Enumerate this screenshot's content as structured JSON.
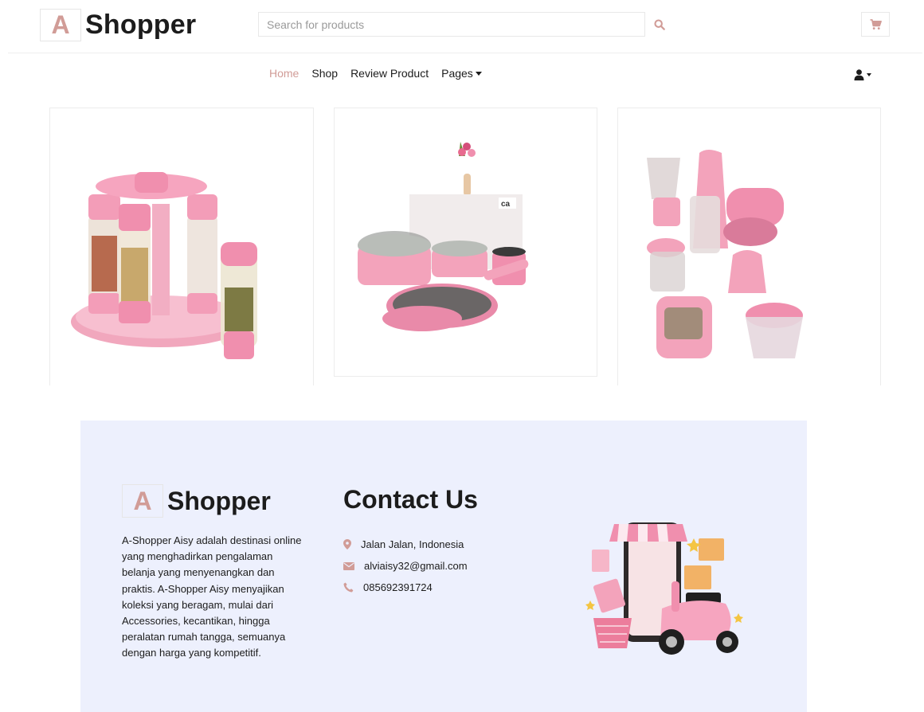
{
  "brand": {
    "logo_letter": "A",
    "logo_word": "Shopper"
  },
  "search": {
    "placeholder": "Search for products"
  },
  "colors": {
    "accent": "#d19c97",
    "footer_bg": "#edf0fd",
    "text": "#1c1c1c"
  },
  "icons": {
    "search": "search-icon",
    "cart": "cart-icon",
    "user": "user-icon",
    "location": "map-marker-icon",
    "email": "envelope-icon",
    "phone": "phone-icon"
  },
  "nav": {
    "items": [
      {
        "label": "Home",
        "active": true
      },
      {
        "label": "Shop"
      },
      {
        "label": "Review Product"
      },
      {
        "label": "Pages"
      }
    ]
  },
  "footer": {
    "about": "A-Shopper Aisy adalah destinasi online yang menghadirkan pengalaman belanja yang menyenangkan dan praktis. A-Shopper Aisy menyajikan koleksi yang beragam, mulai dari Accessories, kecantikan, hingga peralatan rumah tangga, semuanya dengan harga yang kompetitif.",
    "contact_title": "Contact Us",
    "address": "Jalan Jalan, Indonesia",
    "email": "alviaisy32@gmail.com",
    "phone": "085692391724"
  }
}
